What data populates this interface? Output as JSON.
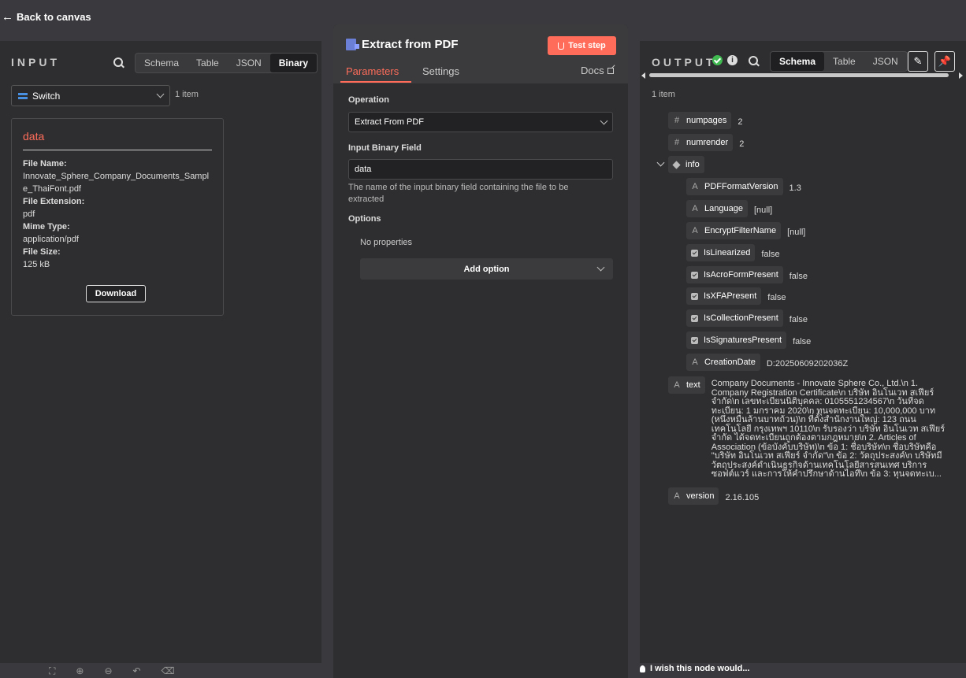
{
  "nav": {
    "back_label": "Back to canvas"
  },
  "input": {
    "title": "INPUT",
    "tabs": [
      "Schema",
      "Table",
      "JSON",
      "Binary"
    ],
    "active_tab": "Binary",
    "node_select": "Switch",
    "item_count": "1 item",
    "card": {
      "title": "data",
      "file_name_label": "File Name:",
      "file_name": "Innovate_Sphere_Company_Documents_Sample_ThaiFont.pdf",
      "file_ext_label": "File Extension:",
      "file_ext": "pdf",
      "mime_label": "Mime Type:",
      "mime": "application/pdf",
      "size_label": "File Size:",
      "size": "125 kB",
      "download_label": "Download"
    }
  },
  "node": {
    "title": "Extract from PDF",
    "test_label": "Test step",
    "tabs": {
      "parameters": "Parameters",
      "settings": "Settings"
    },
    "docs_label": "Docs",
    "operation_label": "Operation",
    "operation_value": "Extract From PDF",
    "binary_field_label": "Input Binary Field",
    "binary_field_value": "data",
    "binary_field_hint": "The name of the input binary field containing the file to be extracted",
    "options_label": "Options",
    "no_props": "No properties",
    "add_option_label": "Add option"
  },
  "output": {
    "title": "OUTPUT",
    "tabs": [
      "Schema",
      "Table",
      "JSON"
    ],
    "active_tab": "Schema",
    "item_count": "1 item",
    "fields": {
      "numpages": {
        "key": "numpages",
        "value": "2"
      },
      "numrender": {
        "key": "numrender",
        "value": "2"
      },
      "info": {
        "key": "info"
      },
      "PDFFormatVersion": {
        "key": "PDFFormatVersion",
        "value": "1.3"
      },
      "Language": {
        "key": "Language",
        "value": "[null]"
      },
      "EncryptFilterName": {
        "key": "EncryptFilterName",
        "value": "[null]"
      },
      "IsLinearized": {
        "key": "IsLinearized",
        "value": "false"
      },
      "IsAcroFormPresent": {
        "key": "IsAcroFormPresent",
        "value": "false"
      },
      "IsXFAPresent": {
        "key": "IsXFAPresent",
        "value": "false"
      },
      "IsCollectionPresent": {
        "key": "IsCollectionPresent",
        "value": "false"
      },
      "IsSignaturesPresent": {
        "key": "IsSignaturesPresent",
        "value": "false"
      },
      "CreationDate": {
        "key": "CreationDate",
        "value": "D:20250609202036Z"
      },
      "text": {
        "key": "text",
        "value": "Company Documents - Innovate Sphere Co., Ltd.\\n 1. Company Registration Certificate\\n บริษัท อินโนเวท สเฟียร์ จำกัด\\n เลขทะเบียนนิติบุคคล: 0105551234567\\n วันที่จดทะเบียน: 1 มกราคม 2020\\n ทุนจดทะเบียน: 10,000,000 บาท (หนึ่งหมื่นล้านบาทถ้วน)\\n ที่ตั้งสำนักงานใหญ่: 123 ถนนเทคโนโลยี กรุงเทพฯ 10110\\n รับรองว่า บริษัท อินโนเวท สเฟียร์ จำกัด ได้จดทะเบียนถูกต้องตามกฎหมาย\\n 2. Articles of Association (ข้อบังคับบริษัท)\\n ข้อ 1: ชื่อบริษัท\\n ชื่อบริษัทคือ \"บริษัท อินโนเวท สเฟียร์ จำกัด\"\\n ข้อ 2: วัตถุประสงค์\\n บริษัทมีวัตถุประสงค์ดำเนินธุรกิจด้านเทคโนโลยีสารสนเทศ บริการซอฟต์แวร์ และการให้คำปรึกษาด้านไอที\\n ข้อ 3: ทุนจดทะเบ..."
      },
      "version": {
        "key": "version",
        "value": "2.16.105"
      }
    }
  },
  "footer": {
    "wish_label": "I wish this node would..."
  },
  "colors": {
    "accent": "#ff6d5a",
    "success": "#3fb950",
    "switch": "#4a90e2"
  }
}
